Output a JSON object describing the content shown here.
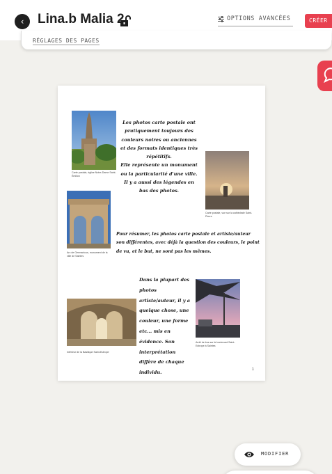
{
  "header": {
    "title": "Lina.b Malia 2",
    "back_icon": "chevron-left-icon",
    "lock_icon": "unlock-icon",
    "options_label": "OPTIONS AVANCÉES",
    "options_icon": "sliders-icon",
    "create_label": "CRÉER"
  },
  "panel": {
    "settings_link": "RÉGLAGES DES PAGES"
  },
  "chat": {
    "icon": "speech-bubble-icon",
    "color": "#e8404f"
  },
  "page": {
    "paragraph1": [
      "Les photos carte postale ont pratiquement toujours des couleurs noires ou anciennes et des formats identiques très répétitifs.",
      "Elle représente un monument ou la particularité d'une ville.",
      "Il y a aussi des légendes en bas des photos."
    ],
    "paragraph2": "Pour résumer, les photos carte postale et artiste/auteur son différentes, avec déjà la question des couleurs, le point de vu, et le but, ne sont pas les mêmes.",
    "paragraph3": "Dans la plupart des photos artiste/auteur, il y a quelque chose, une couleur, une forme etc... mis en évidence. Son interprétation diffère de chaque individu.",
    "captions": {
      "photo1": "Carte postale, église Notre-Dame Saint-Émilion",
      "photo2": "Carte postale, vue sur la cathédrale Saint-Pierre",
      "photo3": "Arc de Germanicus, monument de la ville de Saintes",
      "photo4": "Intérieur de la Basilique Saint-Eutrope",
      "photo5": "Arrêt de bus sur le boulevard Saint-Eutrope à Saintes"
    },
    "page_number": "1"
  },
  "footer": {
    "modify_label": "MODIFIER",
    "modify_icon": "eye-icon"
  },
  "colors": {
    "accent": "#e8404f",
    "background": "#f2f1ed"
  }
}
